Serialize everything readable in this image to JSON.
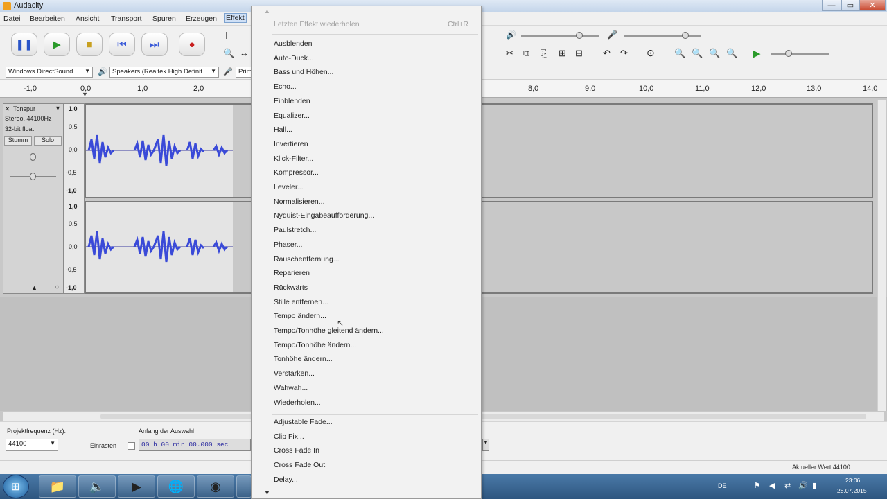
{
  "window": {
    "title": "Audacity",
    "minimize": "—",
    "maximize": "▭",
    "close": "✕"
  },
  "menubar": [
    "Datei",
    "Bearbeiten",
    "Ansicht",
    "Transport",
    "Spuren",
    "Erzeugen",
    "Effekt"
  ],
  "devices": {
    "host": "Windows DirectSound",
    "output": "Speakers (Realtek High Definit",
    "input": "Prim"
  },
  "ruler": {
    "ticks_left": [
      "-1,0",
      "0,0",
      "1,0",
      "2,0"
    ],
    "ticks_right": [
      "8,0",
      "9,0",
      "10,0",
      "11,0",
      "12,0",
      "13,0",
      "14,0"
    ]
  },
  "track": {
    "name": "Tonspur",
    "info1": "Stereo, 44100Hz",
    "info2": "32-bit float",
    "mute": "Stumm",
    "solo": "Solo",
    "scale": [
      "1,0",
      "0,5",
      "0,0",
      "-0,5",
      "-1,0"
    ]
  },
  "effect_menu": {
    "repeat": "Letzten Effekt wiederholen",
    "repeat_shortcut": "Ctrl+R",
    "items": [
      "Ausblenden",
      "Auto-Duck...",
      "Bass und Höhen...",
      "Echo...",
      "Einblenden",
      "Equalizer...",
      "Hall...",
      "Invertieren",
      "Klick-Filter...",
      "Kompressor...",
      "Leveler...",
      "Normalisieren...",
      "Nyquist-Eingabeaufforderung...",
      "Paulstretch...",
      "Phaser...",
      "Rauschentfernung...",
      "Reparieren",
      "Rückwärts",
      "Stille entfernen...",
      "Tempo ändern...",
      "Tempo/Tonhöhe gleitend ändern...",
      "Tempo/Tonhöhe ändern...",
      "Tonhöhe ändern...",
      "Verstärken...",
      "Wahwah...",
      "Wiederholen..."
    ],
    "plugins": [
      "Adjustable Fade...",
      "Clip Fix...",
      "Cross Fade In",
      "Cross Fade Out",
      "Delay..."
    ]
  },
  "selection_bar": {
    "rate_label": "Projektfrequenz (Hz):",
    "rate_value": "44100",
    "snap_label": "Einrasten",
    "start_label": "Anfang der Auswahl",
    "start_value": "00 h 00 min 00.000 sec"
  },
  "status": {
    "right": "Aktueller Wert 44100"
  },
  "taskbar": {
    "lang": "DE",
    "time": "23:06",
    "date": "28.07.2015"
  }
}
